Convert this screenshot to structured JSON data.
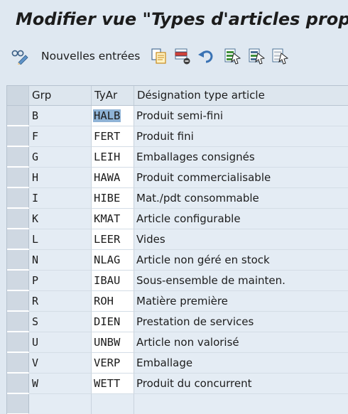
{
  "window": {
    "title": "Modifier vue \"Types d'articles proposés\""
  },
  "toolbar": {
    "new_entries_label": "Nouvelles entrées",
    "icons": [
      "glasses-pencil-icon",
      "copy-icon",
      "delete-icon",
      "undo-icon",
      "select-all-icon",
      "select-block-icon",
      "deselect-all-icon"
    ]
  },
  "table": {
    "columns": [
      "Grp",
      "TyAr",
      "Désignation type article"
    ],
    "rows": [
      {
        "grp": "B",
        "tyar": "HALB",
        "desc": "Produit semi-fini"
      },
      {
        "grp": "F",
        "tyar": "FERT",
        "desc": "Produit fini"
      },
      {
        "grp": "G",
        "tyar": "LEIH",
        "desc": "Emballages consignés"
      },
      {
        "grp": "H",
        "tyar": "HAWA",
        "desc": "Produit commercialisable"
      },
      {
        "grp": "I",
        "tyar": "HIBE",
        "desc": "Mat./pdt consommable"
      },
      {
        "grp": "K",
        "tyar": "KMAT",
        "desc": "Article configurable"
      },
      {
        "grp": "L",
        "tyar": "LEER",
        "desc": "Vides"
      },
      {
        "grp": "N",
        "tyar": "NLAG",
        "desc": "Article non géré en stock"
      },
      {
        "grp": "P",
        "tyar": "IBAU",
        "desc": "Sous-ensemble de mainten."
      },
      {
        "grp": "R",
        "tyar": "ROH",
        "desc": "Matière première"
      },
      {
        "grp": "S",
        "tyar": "DIEN",
        "desc": "Prestation de services"
      },
      {
        "grp": "U",
        "tyar": "UNBW",
        "desc": "Article non valorisé"
      },
      {
        "grp": "V",
        "tyar": "VERP",
        "desc": "Emballage"
      },
      {
        "grp": "W",
        "tyar": "WETT",
        "desc": "Produit du concurrent"
      }
    ]
  }
}
